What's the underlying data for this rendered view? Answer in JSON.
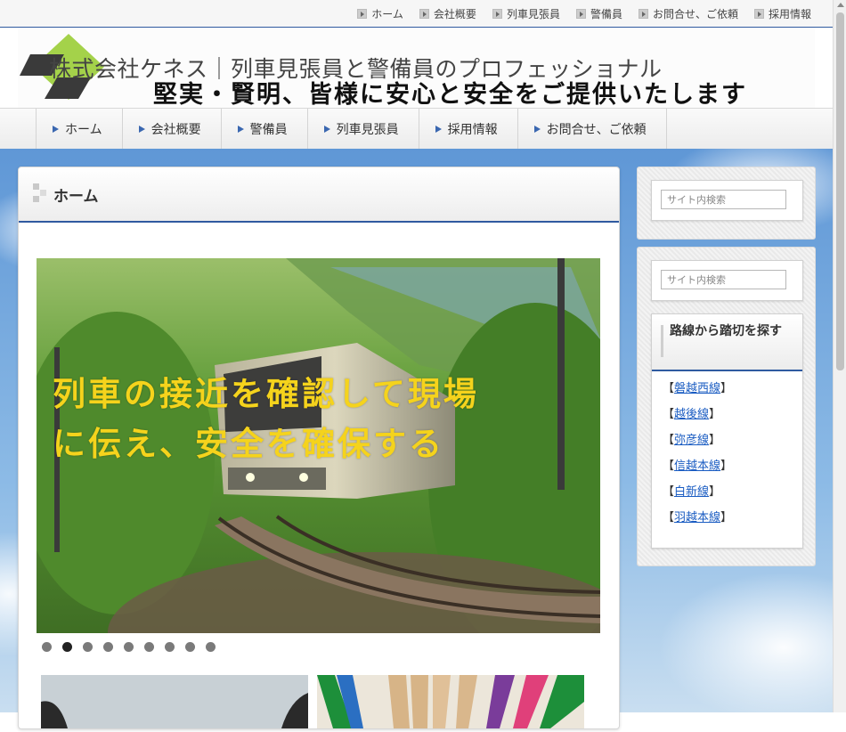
{
  "topbar": {
    "links": [
      "ホーム",
      "会社概要",
      "列車見張員",
      "警備員",
      "お問合せ、ご依頼",
      "採用情報"
    ]
  },
  "header": {
    "company_name": "株式会社ケネス｜列車見張員と警備員のプロフェッショナル",
    "tagline": "堅実・賢明、皆様に安心と安全をご提供いたします",
    "logo_colors": {
      "green": "#a4d24a",
      "dark": "#3a3a3a"
    }
  },
  "nav": {
    "items": [
      "ホーム",
      "会社概要",
      "警備員",
      "列車見張員",
      "採用情報",
      "お問合せ、ご依頼"
    ]
  },
  "main": {
    "title": "ホーム",
    "slider": {
      "caption_line1": "列車の接近を確認して現場",
      "caption_line2": "に伝え、安全を確保する",
      "dot_count": 9,
      "active_index": 1
    }
  },
  "sidebar": {
    "search1_placeholder": "サイト内検索",
    "search2_placeholder": "サイト内検索",
    "widget_title": "路線から踏切を探す",
    "lines": [
      "磐越西線",
      "越後線",
      "弥彦線",
      "信越本線",
      "白新線",
      "羽越本線"
    ]
  },
  "colors": {
    "accent": "#2f5aa0",
    "caption": "#f5d31c",
    "link": "#1a5cc2"
  }
}
